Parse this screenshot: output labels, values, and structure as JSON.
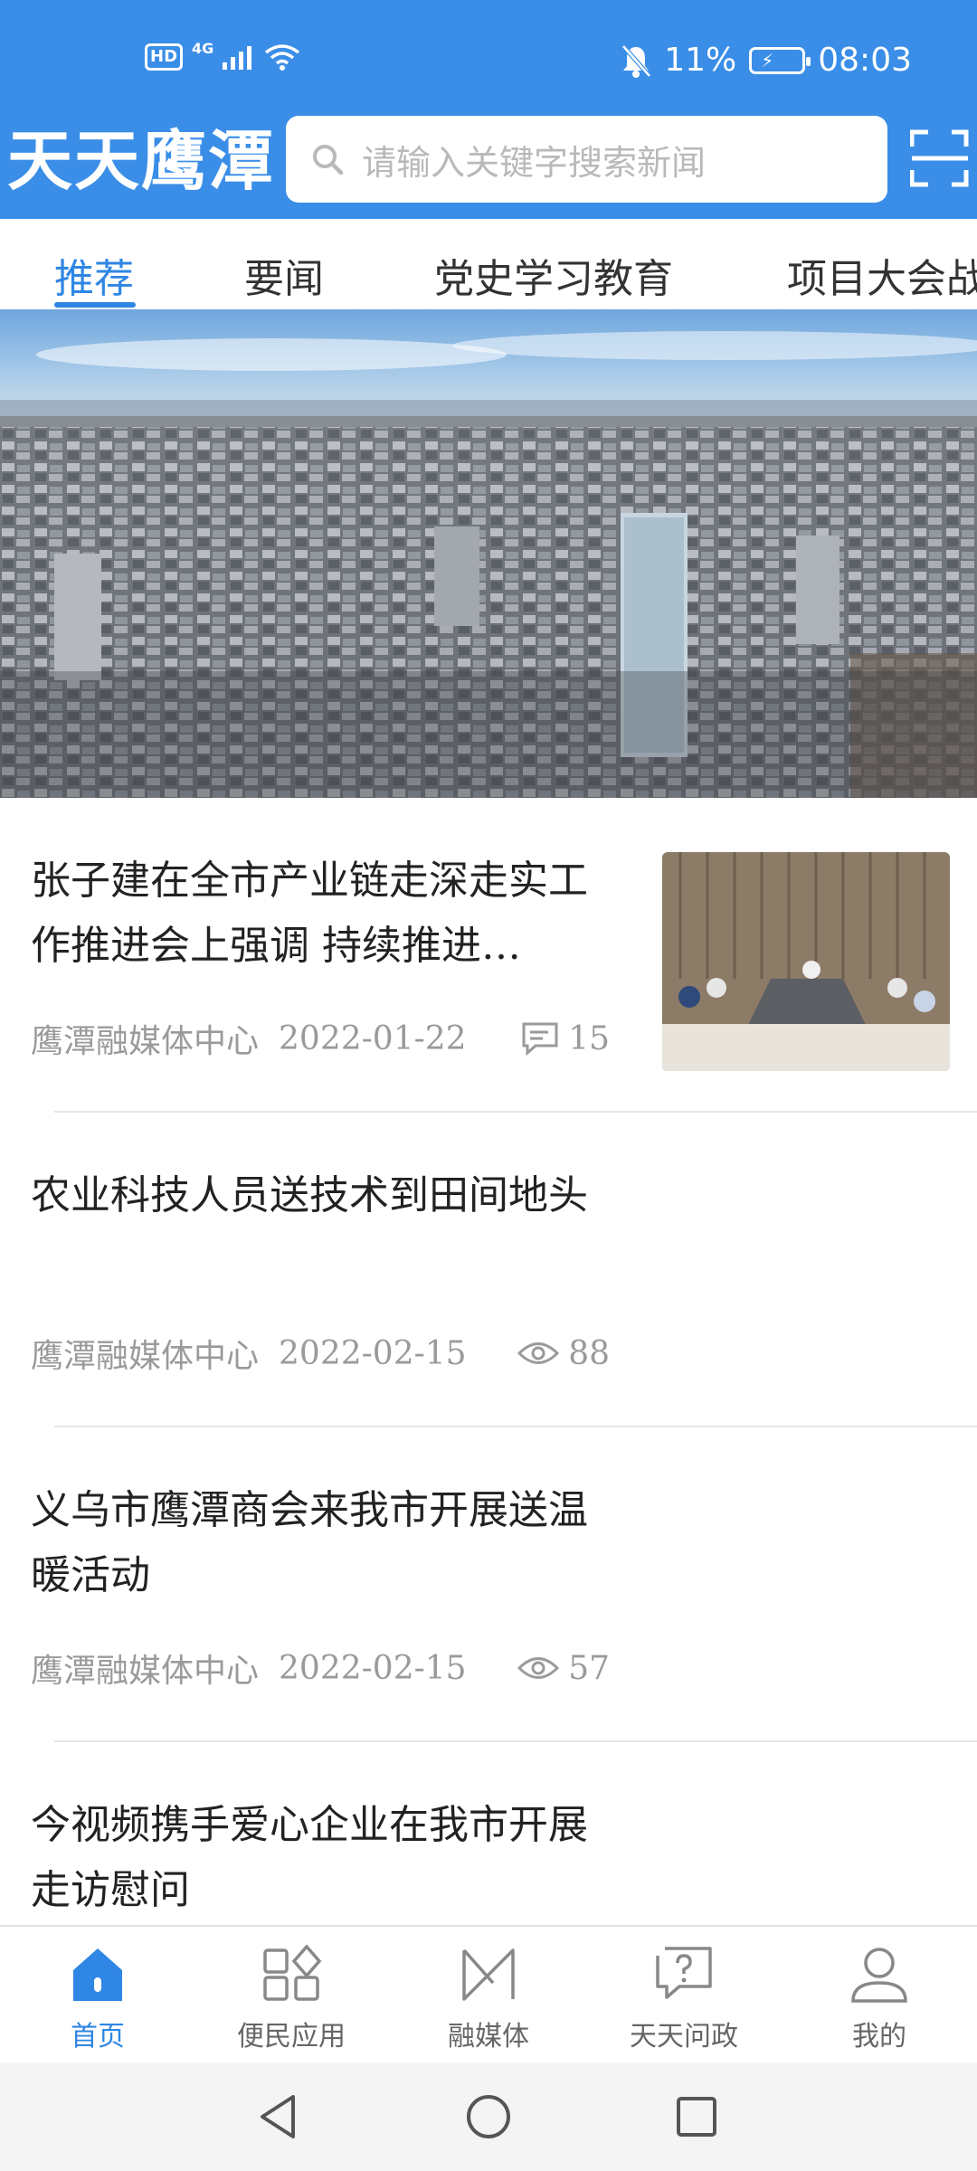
{
  "status_bar": {
    "left_hd": "HD",
    "left_network": "4G",
    "battery_percent": "11%",
    "time": "08:03"
  },
  "app_bar": {
    "title": "天天鹰潭",
    "search_placeholder": "请输入关键字搜索新闻"
  },
  "tabs": [
    {
      "label": "推荐",
      "active": true
    },
    {
      "label": "要闻",
      "active": false
    },
    {
      "label": "党史学习教育",
      "active": false
    },
    {
      "label": "项目大会战",
      "active": false
    }
  ],
  "news": [
    {
      "title": "张子建在全市产业链走深走实工作推进会上强调 持续推进…",
      "source": "鹰潭融媒体中心",
      "date": "2022-01-22",
      "stat_type": "comment",
      "stat_value": "15",
      "has_thumb": true
    },
    {
      "title": "农业科技人员送技术到田间地头",
      "source": "鹰潭融媒体中心",
      "date": "2022-02-15",
      "stat_type": "views",
      "stat_value": "88",
      "has_thumb": false
    },
    {
      "title": "义乌市鹰潭商会来我市开展送温暖活动",
      "source": "鹰潭融媒体中心",
      "date": "2022-02-15",
      "stat_type": "views",
      "stat_value": "57",
      "has_thumb": false
    },
    {
      "title": "今视频携手爱心企业在我市开展走访慰问",
      "source": "",
      "date": "",
      "stat_type": "",
      "stat_value": "",
      "has_thumb": false
    }
  ],
  "bottom_nav": [
    {
      "label": "首页",
      "icon": "home-icon",
      "active": true
    },
    {
      "label": "便民应用",
      "icon": "apps-icon",
      "active": false
    },
    {
      "label": "融媒体",
      "icon": "media-icon",
      "active": false
    },
    {
      "label": "天天问政",
      "icon": "question-icon",
      "active": false
    },
    {
      "label": "我的",
      "icon": "user-icon",
      "active": false
    }
  ],
  "colors": {
    "primary": "#3a8ee8",
    "active_tab": "#2f86e4",
    "meta_text": "#9a9a9a"
  }
}
